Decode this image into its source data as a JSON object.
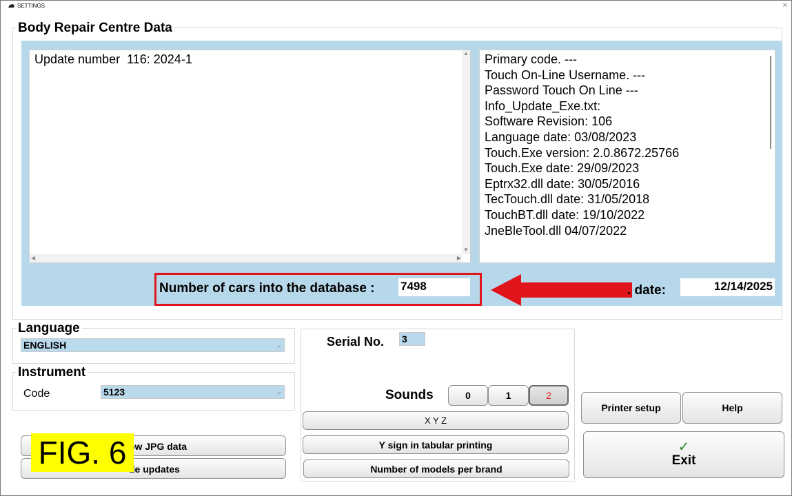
{
  "window": {
    "title": "SETTINGS"
  },
  "repair_centre": {
    "title": "Body Repair Centre Data",
    "update_text": "Update number  116: 2024-1",
    "info_lines": [
      "Primary code. ---",
      "Touch On-Line Username. ---",
      "Password Touch On Line ---",
      "",
      "Info_Update_Exe.txt:",
      "",
      "Software Revision: 106",
      "Language date: 03/08/2023",
      "Touch.Exe version: 2.0.8672.25766",
      "Touch.Exe date: 29/09/2023",
      "Eptrx32.dll date: 30/05/2016",
      "TecTouch.dll date: 31/05/2018",
      "TouchBT.dll date: 19/10/2022",
      "JneBleTool.dll 04/07/2022"
    ],
    "cars_label": "Number of cars into the database :",
    "cars_value": "7498",
    "date_label": ". date:",
    "date_value": "12/14/2025"
  },
  "language": {
    "title": "Language",
    "value": "ENGLISH"
  },
  "instrument": {
    "title": "Instrument",
    "code_label": "Code",
    "code_value": "5123"
  },
  "serial": {
    "label": "Serial No.",
    "value": "3"
  },
  "sounds": {
    "label": "Sounds",
    "options": [
      "0",
      "1",
      "2"
    ],
    "selected": "2"
  },
  "buttons": {
    "xyz": "X Y Z",
    "y_sign": "Y sign in tabular printing",
    "models_per_brand": "Number of models per brand",
    "jpg": "ow JPG data",
    "updates": "de updates",
    "printer_setup": "Printer setup",
    "help": "Help",
    "exit": "Exit",
    "exit_check": "✓"
  },
  "overlay": {
    "fig_label": "FIG. 6"
  },
  "colors": {
    "highlight_red": "#e0141b",
    "field_blue": "#b7d8ea",
    "sound_selected": "#e02020",
    "fig_bg": "#ffff00",
    "check": "#2e8b2e"
  }
}
